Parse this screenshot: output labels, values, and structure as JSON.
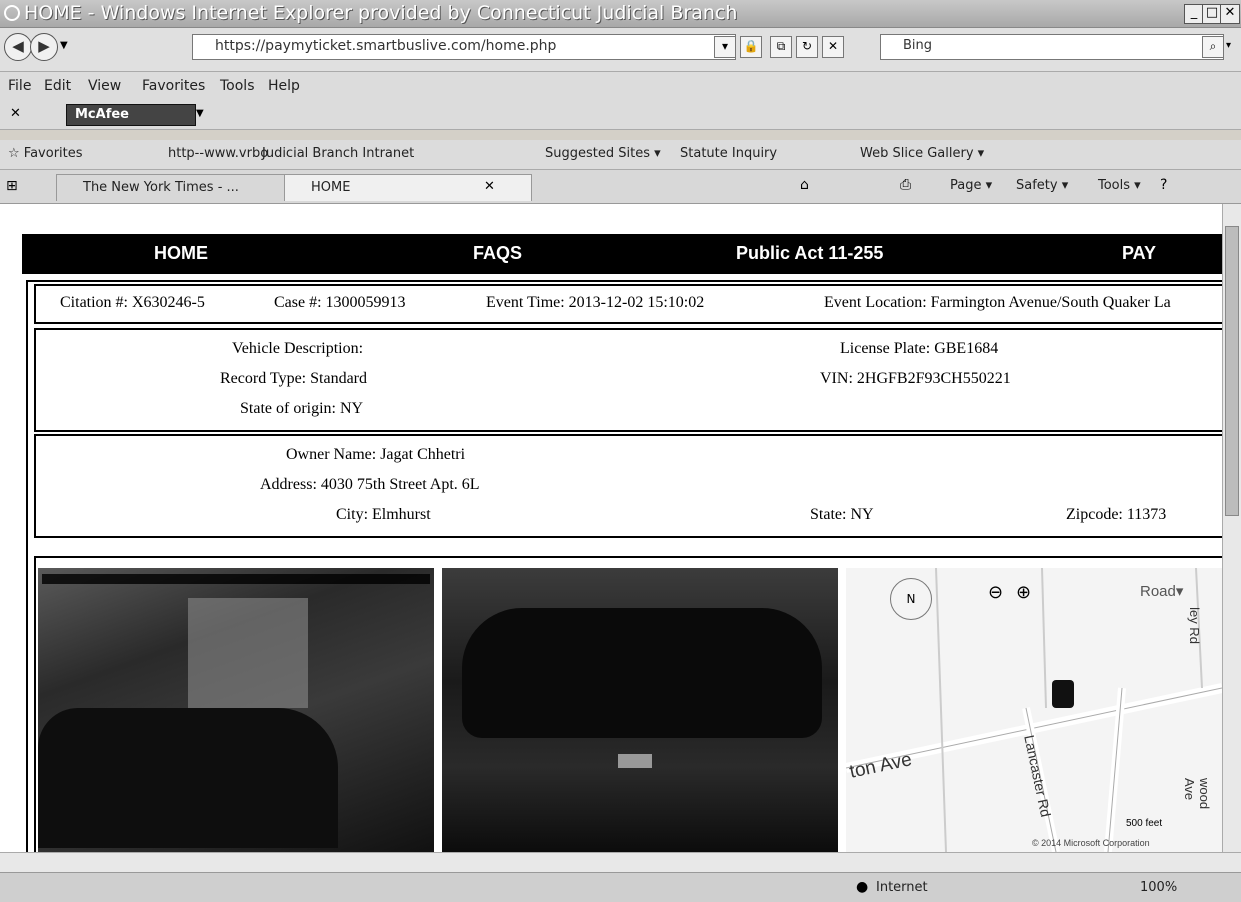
{
  "window": {
    "title": "HOME - Windows Internet Explorer provided by Connecticut Judicial Branch"
  },
  "address_bar": {
    "url": "https://paymyticket.smartbuslive.com/home.php",
    "search_placeholder": "Bing"
  },
  "menu": [
    "File",
    "Edit",
    "View",
    "Favorites",
    "Tools",
    "Help"
  ],
  "toolbar": {
    "mcafee_label": "McAfee"
  },
  "favorites": {
    "label": "Favorites",
    "links": [
      "http--www.vrbo",
      "Judicial Branch Intranet",
      "Suggested Sites ▾",
      "Statute Inquiry",
      "Web Slice Gallery ▾"
    ]
  },
  "tabs": [
    {
      "label": "The New York Times - ..."
    },
    {
      "label": "HOME"
    }
  ],
  "commands": [
    "Page ▾",
    "Safety ▾",
    "Tools ▾"
  ],
  "site_nav": [
    "HOME",
    "FAQS",
    "Public Act 11-255",
    "PAY"
  ],
  "citation": {
    "citation_no": "Citation #: X630246-5",
    "case_no": "Case #: 1300059913",
    "event_time": "Event Time: 2013-12-02 15:10:02",
    "event_location": "Event Location: Farmington Avenue/South Quaker La"
  },
  "vehicle": {
    "description": "Vehicle Description:",
    "record_type": "Record Type: Standard",
    "state_of_origin": "State of origin: NY",
    "license_plate": "License Plate: GBE1684",
    "vin": "VIN: 2HGFB2F93CH550221"
  },
  "owner": {
    "name": "Owner Name: Jagat Chhetri",
    "address": "Address: 4030 75th Street Apt. 6L",
    "city": "City: Elmhurst",
    "state": "State: NY",
    "zipcode": "Zipcode: 11373"
  },
  "map": {
    "mode": "Road▾",
    "streets": [
      "ton Ave",
      "Lancaster Rd",
      "ley Rd",
      "wood Ave"
    ],
    "scale": "500 feet",
    "copyright": "© 2014 Microsoft Corporation"
  },
  "status": {
    "zone": "Internet",
    "zoom": "100%"
  },
  "colors": {
    "nav_bg": "#000000",
    "nav_text": "#ffffff",
    "page_bg": "#ffffff"
  }
}
